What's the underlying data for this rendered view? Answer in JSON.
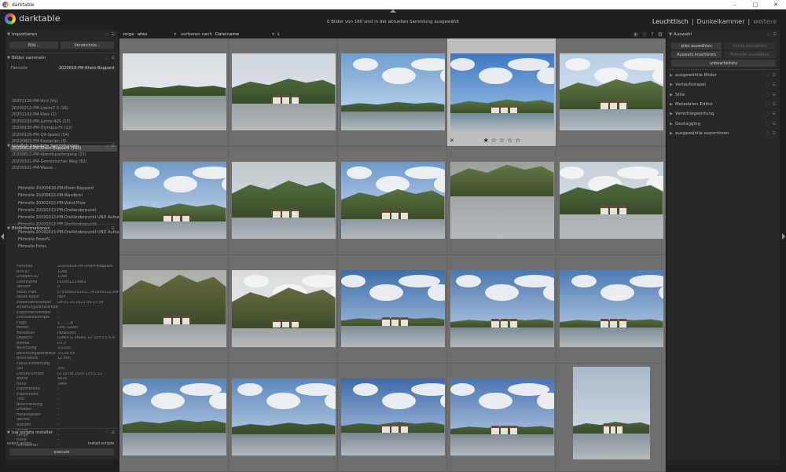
{
  "window": {
    "title": "darktable",
    "minimize": "–",
    "maximize": "□",
    "close": "✕"
  },
  "header": {
    "brand": "darktable",
    "status": "0 Bilder von 160 sind in der aktuellen Sammlung ausgewählt",
    "views": {
      "lighttable": "Leuchttisch",
      "sep1": "|",
      "darkroom": "Dunkelkammer",
      "sep2": "|",
      "more": "weitere"
    }
  },
  "toolbar": {
    "show_label": "zeige",
    "show_value": "alles",
    "sort_label": "sortieren nach",
    "sort_value": "Dateiname",
    "sort_dir": "↓",
    "dropdown": "▾",
    "tool_icons": [
      "⊕",
      "☆",
      "?",
      "⚙"
    ]
  },
  "left": {
    "import": {
      "title": "Importieren",
      "btn_image": "Bild...",
      "btn_folder": "Verzeichnis..."
    },
    "collect": {
      "title": "Bilder sammeln",
      "filter_label": "Filmrolle",
      "filter_value": "2020818-PM-Rhein-Boppard",
      "items": [
        "20201120-PM-Void (Vo)",
        "20200212-PM-Loeiss7-3 (16)",
        "20201102-PM-Kleis (1)",
        "20200205-PM-Lumix-42S (15)",
        "20200130-PM-Olympus75 (12)",
        "20200126-PM-Q9-Speed (54)",
        "20200803-PM-Kastanien (5)",
        "20200818-PM-Rhein-Boppard (160)",
        "20200812-PM-Abendspaziergang (21)",
        "20200101-PM-Gemeinsicher Weg (82)",
        "20200101-PM-Wasse..."
      ],
      "selected_index": 7
    },
    "recent": {
      "title": "kürzlich benutzte Sammlungen",
      "items": [
        "Filmrolle 20200818-PM-Rhein-Boppard",
        "Filmrolle 20200822-PM-Wasdbrol",
        "Filmrolle 20201022-PM-Vokid-Plize",
        "Filmrolle 20191013-PM-Dreiländerpunkt",
        "Filmrolle 20191013-PM-Dreiländerpunkt UND Aufnahm...",
        "Filmrolle 20191013-PM-Dreiländerpunkt",
        "Filmrolle 20191013-PM-Dreiländerpunkt UND Aufnahm...",
        "Filmrolle Fotos%",
        "Filmrolle Fotos"
      ]
    },
    "info": {
      "title": "Bildinformationen",
      "rows": [
        [
          "Filmrolle",
          "20200818-PM-Rhein-Boppard"
        ],
        [
          "Bild-ID",
          "1168"
        ],
        [
          "Gruppen-ID",
          "1168"
        ],
        [
          "Dateiname",
          "P1000122.RW2"
        ],
        [
          "Version",
          "0"
        ],
        [
          "voller Pfad",
          "D:\\Fotos\\2020\\2...\\P1000122.RW2"
        ],
        [
          "lokale Kopie",
          "nein"
        ],
        [
          "Importzeitstempel",
          "Do 07.01.2021 09:27:04"
        ],
        [
          "Änderungszeitstempel",
          "-"
        ],
        [
          "Exportzeitstempel",
          "-"
        ],
        [
          "Druckzeitstempel",
          "-"
        ],
        [
          "Flags",
          "1.........p"
        ],
        [
          "Modell",
          "DMC-GX80"
        ],
        [
          "Hersteller",
          "Panasonic"
        ],
        [
          "Objektiv",
          "LUMIX G VARIO 12-32/F3.5-5.6"
        ],
        [
          "Blende",
          "f/3.5"
        ],
        [
          "Belichtung",
          "1/1300"
        ],
        [
          "Belichtungskorrektur",
          "+0,00 EV"
        ],
        [
          "Brennweite",
          "12 mm"
        ],
        [
          "Fokus-Entfernung",
          "-"
        ],
        [
          "ISO",
          "200"
        ],
        [
          "Datum/Uhrzeit",
          "Di 18.08.2020 15:01:12"
        ],
        [
          "Breite",
          "4816"
        ],
        [
          "Höhe",
          "3464"
        ],
        [
          "Exportbreite",
          "-"
        ],
        [
          "Exporthöhe",
          "-"
        ],
        [
          "Titel",
          "-"
        ],
        [
          "Beschreibung",
          "-"
        ],
        [
          "Urheber",
          "-"
        ],
        [
          "Herausgeber",
          "-"
        ],
        [
          "Rechte",
          "-"
        ],
        [
          "Notizen",
          "-"
        ],
        [
          "Breite",
          "-"
        ],
        [
          "Länge",
          "-"
        ],
        [
          "Höhe",
          "-"
        ],
        [
          "Stichwörter",
          "-"
        ],
        [
          "Kategorien",
          "-"
        ]
      ]
    },
    "lua": {
      "title": "lua scripts installer",
      "select_label": "select action",
      "select_value": "install scripts",
      "execute": "execute"
    }
  },
  "right": {
    "select": {
      "title": "Auswahl",
      "all": "alles auswählen",
      "none": "nichts auswählen",
      "invert": "Auswahl invertieren",
      "film": "Filmrolle auswählen",
      "unedited": "unbearbeitete"
    },
    "modules": [
      "ausgewählte Bilder",
      "Verlaufsstapel",
      "Stile",
      "Metadaten-Editor",
      "Verschlagwortung",
      "Geotagging",
      "ausgewählte exportieren"
    ]
  },
  "lighttable": {
    "hover_cell": 3,
    "rating_stars": [
      "★",
      "☆",
      "☆",
      "☆",
      "☆"
    ],
    "reject": "✕"
  }
}
